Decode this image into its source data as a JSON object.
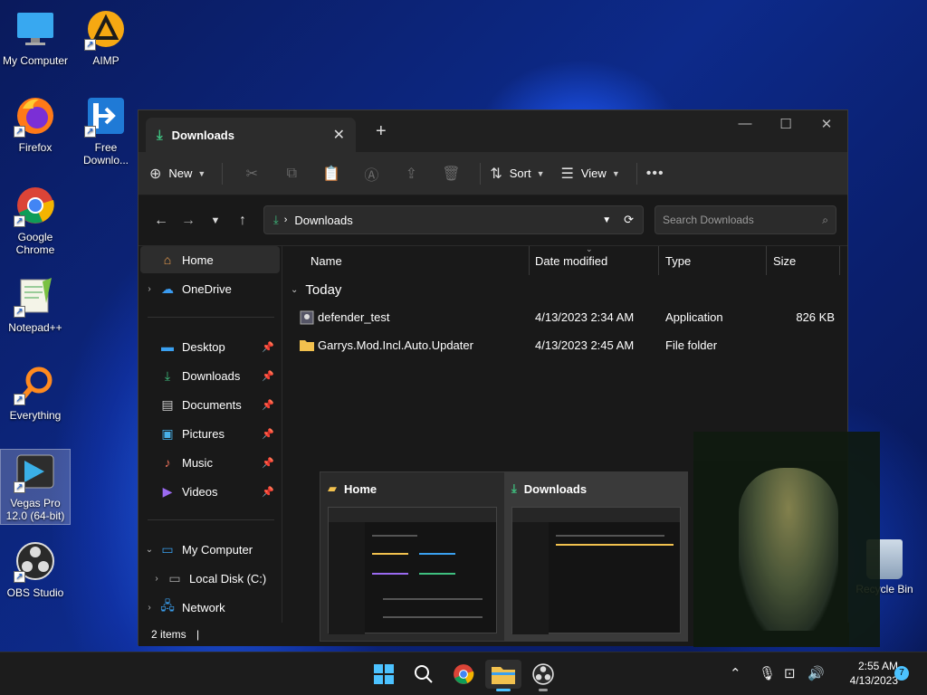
{
  "desktop": {
    "icons": [
      {
        "label": "My Computer"
      },
      {
        "label": "AIMP"
      },
      {
        "label": "Firefox"
      },
      {
        "label": "Free Downlo..."
      },
      {
        "label": "Google Chrome"
      },
      {
        "label": "Notepad++"
      },
      {
        "label": "Everything"
      },
      {
        "label": "Vegas Pro 12.0 (64-bit)"
      },
      {
        "label": "OBS Studio"
      }
    ],
    "recycle_bin": "Recycle Bin"
  },
  "explorer": {
    "tab_title": "Downloads",
    "toolbar": {
      "new_label": "New",
      "sort_label": "Sort",
      "view_label": "View"
    },
    "address": {
      "path": "Downloads",
      "search_placeholder": "Search Downloads"
    },
    "sidebar": {
      "items": [
        {
          "label": "Home"
        },
        {
          "label": "OneDrive"
        },
        {
          "label": "Desktop"
        },
        {
          "label": "Downloads"
        },
        {
          "label": "Documents"
        },
        {
          "label": "Pictures"
        },
        {
          "label": "Music"
        },
        {
          "label": "Videos"
        },
        {
          "label": "My Computer"
        },
        {
          "label": "Local Disk (C:)"
        },
        {
          "label": "Network"
        }
      ]
    },
    "columns": {
      "name": "Name",
      "date": "Date modified",
      "type": "Type",
      "size": "Size"
    },
    "group": "Today",
    "files": [
      {
        "name": "defender_test",
        "date": "4/13/2023 2:34 AM",
        "type": "Application",
        "size": "826 KB"
      },
      {
        "name": "Garrys.Mod.Incl.Auto.Updater",
        "date": "4/13/2023 2:45 AM",
        "type": "File folder",
        "size": ""
      }
    ],
    "status": "2 items"
  },
  "preview": {
    "cards": [
      {
        "title": "Home"
      },
      {
        "title": "Downloads"
      }
    ]
  },
  "taskbar": {
    "time": "2:55 AM",
    "date": "4/13/2023",
    "notifications": "7"
  },
  "colors": {
    "accent": "#4cc2ff",
    "folder": "#f2c14e",
    "download_green": "#3fbf7f"
  }
}
